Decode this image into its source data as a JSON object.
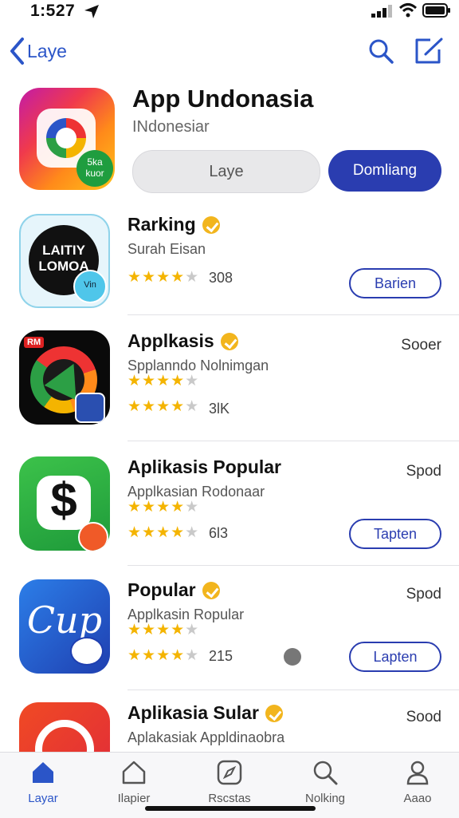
{
  "status": {
    "time": "1:527"
  },
  "nav": {
    "back_label": "Laye"
  },
  "hero": {
    "title": "App Undonasia",
    "subtitle": "INdonesiar",
    "icon_text_line1": "5ka",
    "icon_text_line2": "kuor",
    "gray_button_label": "Laye",
    "blue_button_label": "Domliang"
  },
  "apps": [
    {
      "title": "Rarking",
      "subtitle": "Surah Eisan",
      "icon_text_line1": "LAITIY",
      "icon_text_line2": "LOMOA",
      "icon_badge_text": "Vin",
      "star_rows": [
        4
      ],
      "rating_count": "308",
      "side_text": "",
      "button_label": "Barien"
    },
    {
      "title": "Applkasis",
      "subtitle": "Spplanndo Nolnimgan",
      "icon_tag": "RM",
      "star_rows": [
        4,
        4
      ],
      "rating_count": "3lK",
      "side_text": "Sooer",
      "button_label": ""
    },
    {
      "title": "Aplikasis Popular",
      "subtitle": "Applkasian Rodonaar",
      "icon_glyph": "$",
      "star_rows": [
        4,
        4
      ],
      "rating_count": "6l3",
      "side_text": "Spod",
      "button_label": "Tapten"
    },
    {
      "title": "Popular",
      "subtitle": "Applkasin Ropular",
      "icon_text_line1": "Cup",
      "star_rows": [
        4,
        4
      ],
      "rating_count": "215",
      "side_text": "Spod",
      "button_label": "Lapten"
    },
    {
      "title": "Aplikasia Sular",
      "subtitle": "Aplakasiak Appldinaobra",
      "side_text": "Sood"
    }
  ],
  "tabs": [
    {
      "label": "Layar",
      "icon": "home-icon",
      "active": true
    },
    {
      "label": "Ilapier",
      "icon": "house-outline-icon",
      "active": false
    },
    {
      "label": "Rscstas",
      "icon": "compass-icon",
      "active": false
    },
    {
      "label": "Nolking",
      "icon": "search-icon",
      "active": false
    },
    {
      "label": "Aaao",
      "icon": "person-icon",
      "active": false
    }
  ],
  "colors": {
    "accent": "#2a3db0",
    "link": "#2b55c8",
    "star": "#f4b400"
  }
}
